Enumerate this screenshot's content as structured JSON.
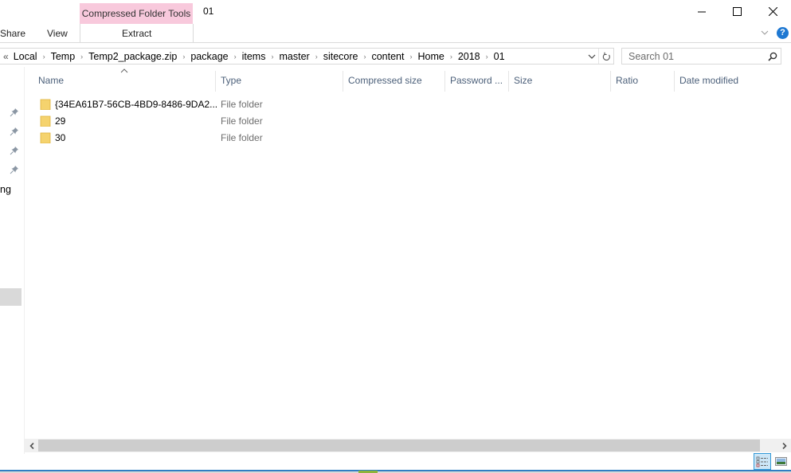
{
  "window": {
    "title": "01",
    "controls": {
      "minimize_icon": "minimize-icon",
      "maximize_icon": "maximize-icon",
      "close_icon": "close-icon"
    }
  },
  "ribbon": {
    "tabs": [
      {
        "label": "Share"
      },
      {
        "label": "View"
      }
    ],
    "contextual_group": {
      "label": "Compressed Folder Tools",
      "color": "#f8c9dc",
      "tab": {
        "label": "Extract"
      }
    },
    "expand_icon": "chevron-down-icon",
    "help_label": "?"
  },
  "address_bar": {
    "overflow_label": "«",
    "crumbs": [
      "Local",
      "Temp",
      "Temp2_package.zip",
      "package",
      "items",
      "master",
      "sitecore",
      "content",
      "Home",
      "2018",
      "01"
    ],
    "separator": "›",
    "refresh_icon": "refresh-icon",
    "dropdown_icon": "chevron-down-icon"
  },
  "search": {
    "placeholder": "Search 01",
    "value": ""
  },
  "nav_pane": {
    "partial_label": "ng",
    "pinned_count": 4
  },
  "columns": [
    {
      "label": "Name"
    },
    {
      "label": "Type"
    },
    {
      "label": "Compressed size"
    },
    {
      "label": "Password ..."
    },
    {
      "label": "Size"
    },
    {
      "label": "Ratio"
    },
    {
      "label": "Date modified"
    }
  ],
  "sort": {
    "column": "Name",
    "direction": "ascending"
  },
  "rows": [
    {
      "name": "{34EA61B7-56CB-4BD9-8486-9DA2...",
      "type": "File folder"
    },
    {
      "name": "29",
      "type": "File folder"
    },
    {
      "name": "30",
      "type": "File folder"
    }
  ],
  "colors": {
    "accent": "#2f7ec3",
    "help": "#1e78d2",
    "header_text": "#4c607a",
    "folder": "#f5d36e"
  }
}
